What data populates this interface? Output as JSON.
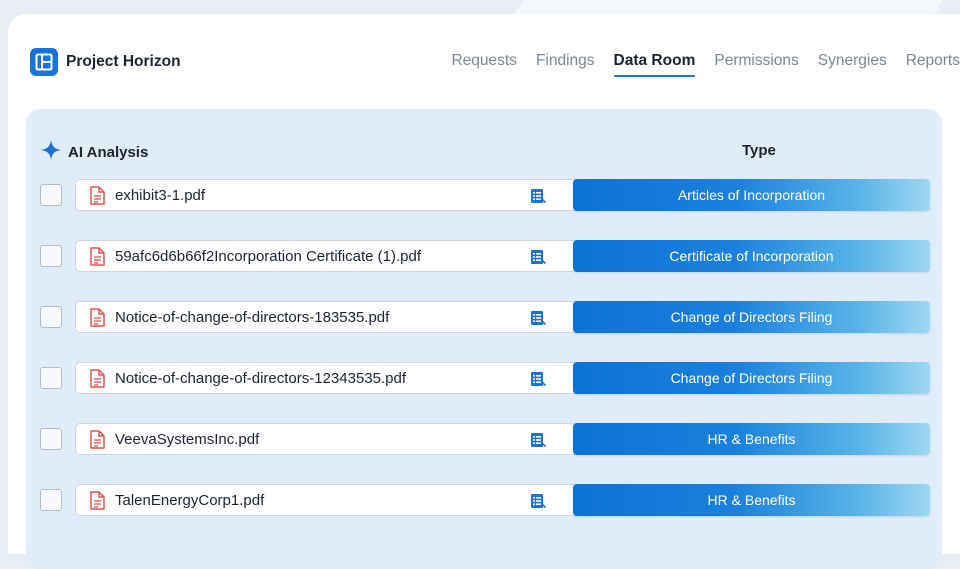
{
  "brand": {
    "name": "Project Horizon"
  },
  "nav": {
    "tabs": [
      {
        "label": "Requests",
        "active": false
      },
      {
        "label": "Findings",
        "active": false
      },
      {
        "label": "Data Room",
        "active": true
      },
      {
        "label": "Permissions",
        "active": false
      },
      {
        "label": "Synergies",
        "active": false
      },
      {
        "label": "Reports",
        "active": false
      }
    ]
  },
  "panel": {
    "ai_label": "AI Analysis",
    "type_header": "Type",
    "rows": [
      {
        "file": "exhibit3-1.pdf",
        "type": "Articles of Incorporation"
      },
      {
        "file": "59afc6d6b66f2Incorporation Certificate (1).pdf",
        "type": "Certificate of Incorporation"
      },
      {
        "file": "Notice-of-change-of-directors-183535.pdf",
        "type": "Change of Directors Filing"
      },
      {
        "file": "Notice-of-change-of-directors-12343535.pdf",
        "type": "Change of Directors Filing"
      },
      {
        "file": "VeevaSystemsInc.pdf",
        "type": "HR & Benefits"
      },
      {
        "file": "TalenEnergyCorp1.pdf",
        "type": "HR & Benefits"
      }
    ]
  },
  "colors": {
    "accent": "#1a73d9",
    "pdf_icon": "#e5534b",
    "panel_bg": "#e1ecfa"
  },
  "icons": {
    "logo": "layout-icon",
    "ai": "sparkle-icon",
    "file": "pdf-file-icon",
    "doc": "document-list-icon"
  }
}
